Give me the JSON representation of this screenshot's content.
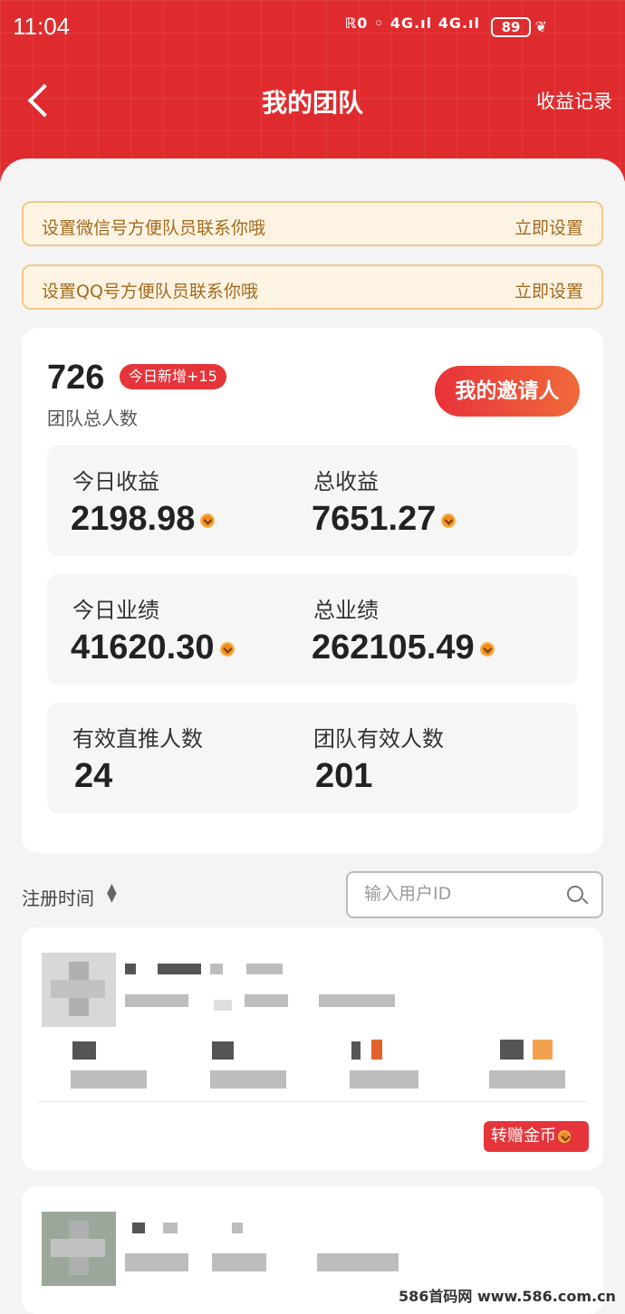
{
  "status_bar": {
    "time": "11:04",
    "icons": "ℝ0 ◦ 4G.ıl 4G.ıl",
    "battery": "89"
  },
  "nav": {
    "title": "我的团队",
    "right_label": "收益记录"
  },
  "notices": [
    {
      "text": "设置微信号方便队员联系你哦",
      "action": "立即设置"
    },
    {
      "text": "设置QQ号方便队员联系你哦",
      "action": "立即设置"
    }
  ],
  "summary": {
    "total_count": "726",
    "today_new": "今日新增+15",
    "total_label": "团队总人数",
    "inviter_button": "我的邀请人"
  },
  "stats": [
    {
      "left_label": "今日收益",
      "left_value": "2198.98",
      "right_label": "总收益",
      "right_value": "7651.27"
    },
    {
      "left_label": "今日业绩",
      "left_value": "41620.30",
      "right_label": "总业绩",
      "right_value": "262105.49"
    },
    {
      "left_label": "有效直推人数",
      "left_value": "24",
      "right_label": "团队有效人数",
      "right_value": "201"
    }
  ],
  "filter": {
    "sort_label": "注册时间",
    "search_placeholder": "输入用户ID"
  },
  "member_card": {
    "transfer_button": "转赠金币"
  },
  "watermark": "586首码网 www.586.com.cn"
}
